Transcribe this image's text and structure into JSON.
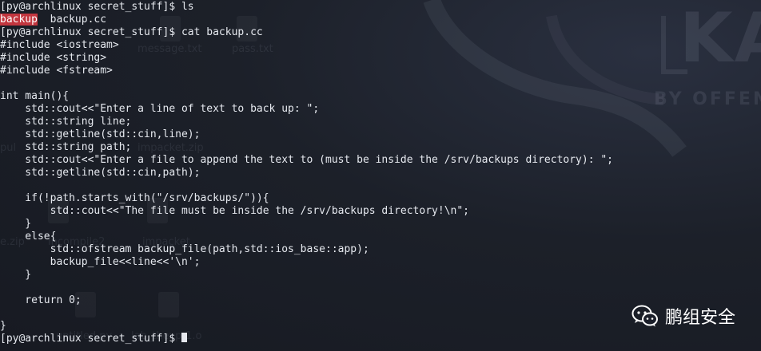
{
  "terminal": {
    "lines": [
      {
        "text": "[py@archlinux secret_stuff]$ ls"
      },
      {
        "segments": [
          {
            "text": "backup",
            "highlight": true
          },
          {
            "text": "  backup.cc",
            "highlight": false
          }
        ]
      },
      {
        "text": "[py@archlinux secret_stuff]$ cat backup.cc"
      },
      {
        "text": "#include <iostream>"
      },
      {
        "text": "#include <string>"
      },
      {
        "text": "#include <fstream>"
      },
      {
        "text": ""
      },
      {
        "text": "int main(){"
      },
      {
        "text": "    std::cout<<\"Enter a line of text to back up: \";"
      },
      {
        "text": "    std::string line;"
      },
      {
        "text": "    std::getline(std::cin,line);"
      },
      {
        "text": "    std::string path;"
      },
      {
        "text": "    std::cout<<\"Enter a file to append the text to (must be inside the /srv/backups directory): \";"
      },
      {
        "text": "    std::getline(std::cin,path);"
      },
      {
        "text": ""
      },
      {
        "text": "    if(!path.starts_with(\"/srv/backups/\")){"
      },
      {
        "text": "        std::cout<<\"The file must be inside the /srv/backups directory!\\n\";"
      },
      {
        "text": "    }"
      },
      {
        "text": "    else{"
      },
      {
        "text": "        std::ofstream backup_file(path,std::ios_base::app);"
      },
      {
        "text": "        backup_file<<line<<'\\n';"
      },
      {
        "text": "    }"
      },
      {
        "text": ""
      },
      {
        "text": "    return 0;"
      },
      {
        "text": ""
      },
      {
        "text": "}"
      },
      {
        "text": "[py@archlinux secret_stuff]$ ",
        "cursor": true
      }
    ],
    "colors": {
      "background": "#1b1f2a",
      "foreground": "#e6e9ef",
      "highlight_bg": "#c2363f"
    }
  },
  "background": {
    "desktop_labels": [
      "message.txt",
      "pass.txt",
      "pul",
      "impacket.zip",
      "e.zip",
      "incompile2",
      "impacket",
      "untitled.py",
      "lab_thexp-1.o"
    ],
    "brand_letters": "KA",
    "brand_sub": "BY OFFEN"
  },
  "watermark": {
    "icon": "wechat-icon",
    "label": "鹏组安全"
  }
}
